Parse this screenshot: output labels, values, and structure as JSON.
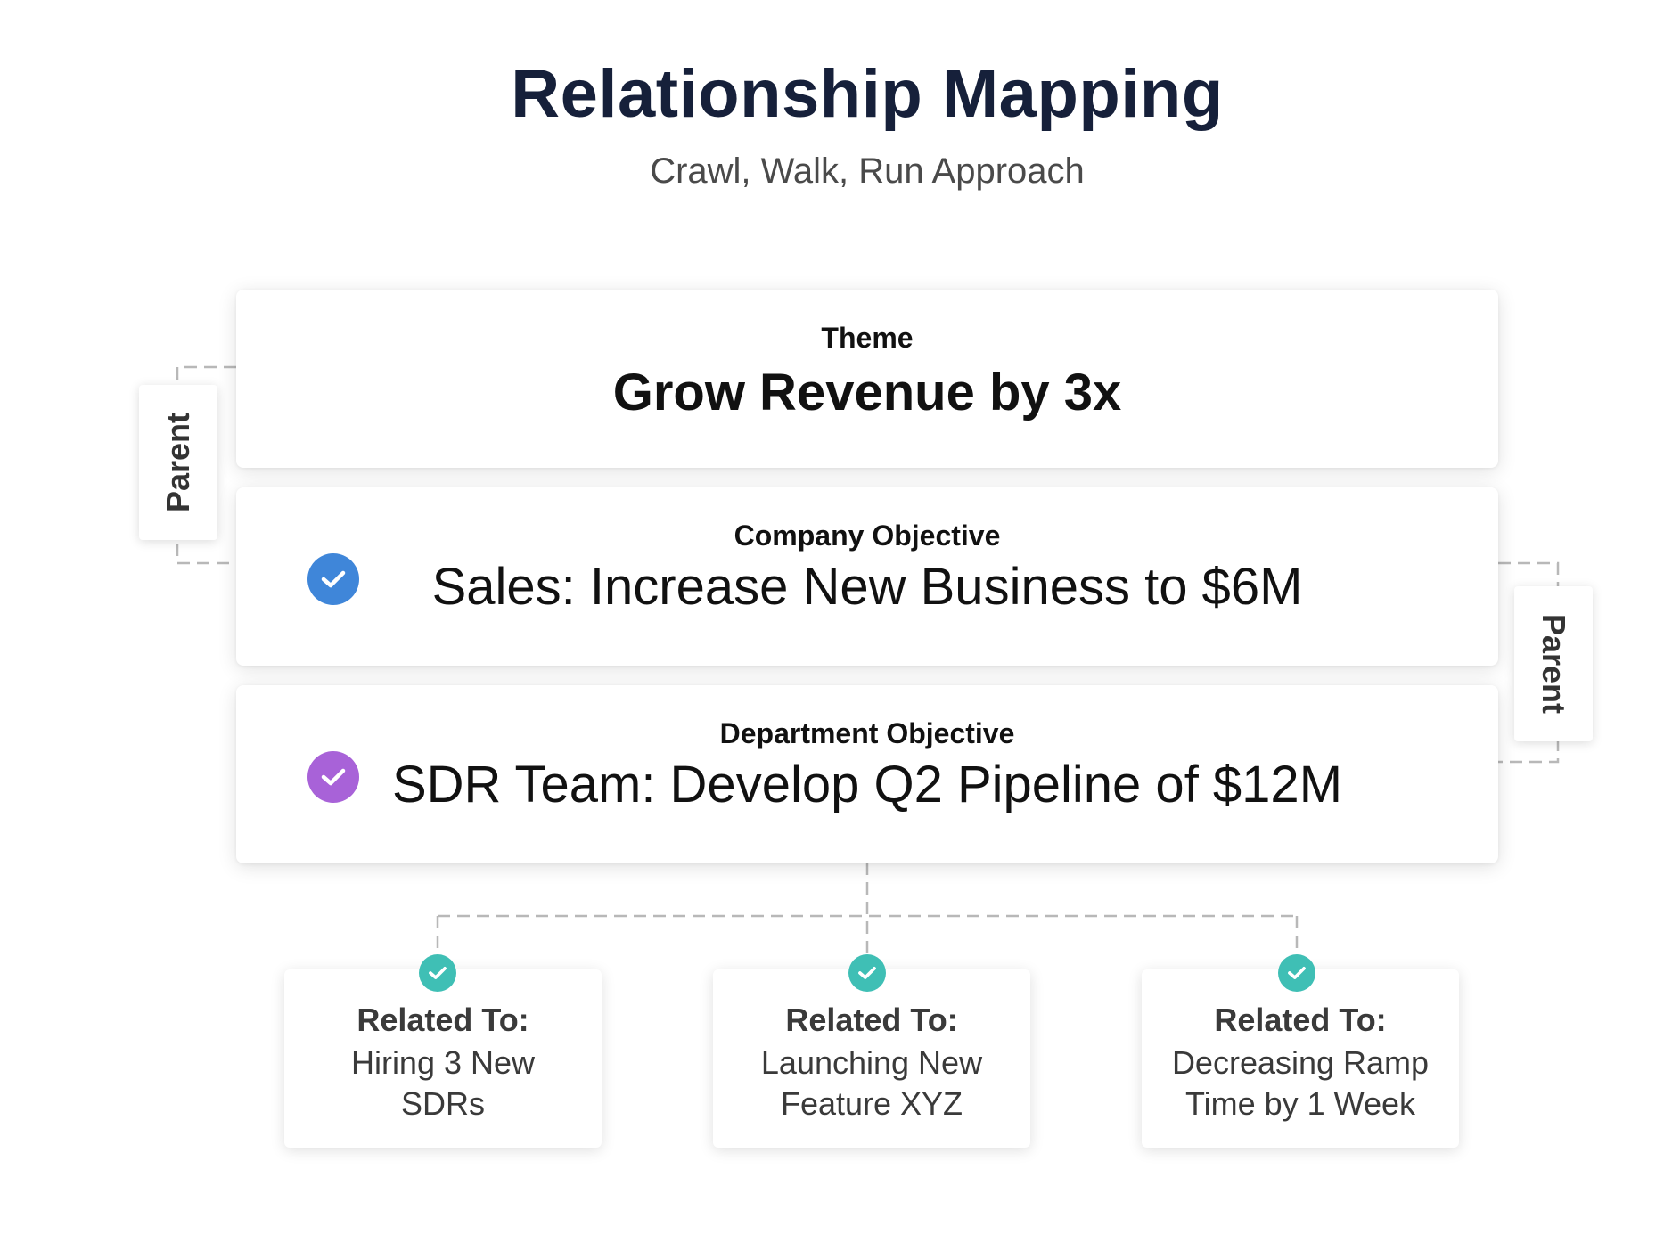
{
  "header": {
    "title": "Relationship Mapping",
    "subtitle": "Crawl, Walk, Run Approach"
  },
  "theme": {
    "label": "Theme",
    "value": "Grow Revenue by 3x"
  },
  "company_objective": {
    "label": "Company Objective",
    "value": "Sales: Increase New Business to $6M",
    "check_icon": "check-circle-icon",
    "check_color": "#3f86d9"
  },
  "department_objective": {
    "label": "Department Objective",
    "value": "SDR Team: Develop Q2 Pipeline of $12M",
    "check_icon": "check-circle-icon",
    "check_color": "#a862d8"
  },
  "side_tabs": {
    "left": "Parent",
    "right": "Parent"
  },
  "related": [
    {
      "heading": "Related To:",
      "line1": "Hiring 3 New",
      "line2": "SDRs"
    },
    {
      "heading": "Related To:",
      "line1": "Launching New",
      "line2": "Feature XYZ"
    },
    {
      "heading": "Related To:",
      "line1": "Decreasing Ramp",
      "line2": "Time by 1 Week"
    }
  ],
  "colors": {
    "title": "#16203a",
    "connector": "#b8b8b8",
    "related_check": "#3fbfb5"
  }
}
